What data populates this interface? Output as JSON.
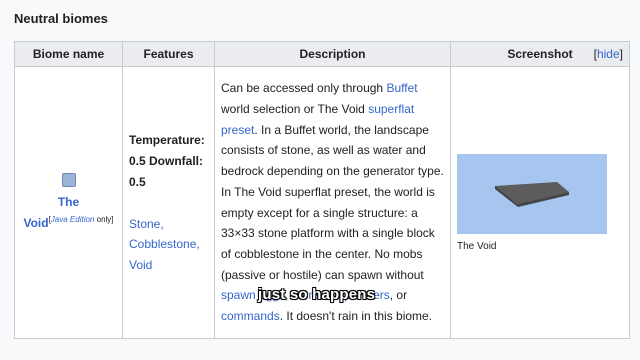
{
  "section_title": "Neutral biomes",
  "table": {
    "headers": {
      "biome_name": "Biome name",
      "features": "Features",
      "description": "Description",
      "screenshot": "Screenshot"
    },
    "hide_link": "hide",
    "row": {
      "biome_icon": "grass-block-icon",
      "name_part1": "The",
      "name_part2": "Void",
      "java_note": "Java Edition",
      "java_note_suffix": " only",
      "temperature": "Temperature: 0.5 Downfall: 0.5",
      "blocks": [
        "Stone,",
        "Cobblestone,",
        "Void"
      ],
      "description": {
        "t1": "Can be accessed only through ",
        "link_buffet": "Buffet",
        "t2": " world selection or The Void ",
        "link_superflat": "superflat preset",
        "t3": ". In a Buffet world, the landscape consists of stone, as well as water and bedrock depending on the generator type. In The Void superflat preset, the world is empty except for a single structure: a 33×33 stone platform with a single block of cobblestone in the center. No mobs (passive or hostile) can spawn without ",
        "link_spawn_eggs": "spawn eggs",
        "t4": ", ",
        "link_spawners": "monster spawners",
        "t5": ", or ",
        "link_commands": "commands",
        "t6": ". It doesn't rain in this biome."
      },
      "screenshot_caption": "The Void"
    }
  },
  "subtitle": "just so happens",
  "colors": {
    "link": "#3366cc",
    "header_bg": "#eaecf0",
    "sky": "#a6c6ef",
    "platform": "#5a5a5a"
  }
}
